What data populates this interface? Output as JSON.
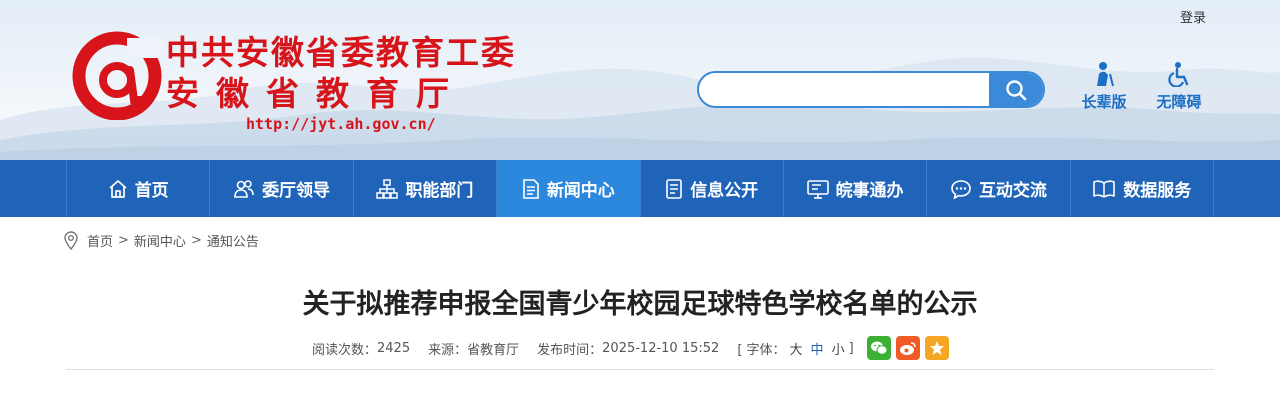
{
  "header": {
    "login_label": "登录",
    "title_line1": "中共安徽省委教育工委",
    "title_line2": "安徽省教育厅",
    "url": "http://jyt.ah.gov.cn/",
    "search": {
      "value": "",
      "placeholder": ""
    },
    "elder_label": "长辈版",
    "accessible_label": "无障碍",
    "brand_red": "#d8141b",
    "accent_blue": "#1c6fc4"
  },
  "nav": {
    "items": [
      {
        "label": "首页",
        "icon": "home-icon"
      },
      {
        "label": "委厅领导",
        "icon": "users-icon"
      },
      {
        "label": "职能部门",
        "icon": "org-chart-icon"
      },
      {
        "label": "新闻中心",
        "icon": "document-icon",
        "active": true
      },
      {
        "label": "信息公开",
        "icon": "list-doc-icon"
      },
      {
        "label": "皖事通办",
        "icon": "monitor-icon"
      },
      {
        "label": "互动交流",
        "icon": "chat-icon"
      },
      {
        "label": "数据服务",
        "icon": "book-icon"
      }
    ],
    "bg_color": "#1f64b8",
    "active_color": "#2b88dd"
  },
  "breadcrumb": {
    "items": [
      "首页",
      "新闻中心",
      "通知公告"
    ],
    "separator": ">"
  },
  "article": {
    "title": "关于拟推荐申报全国青少年校园足球特色学校名单的公示",
    "meta": {
      "views_label": "阅读次数：",
      "views": "2425",
      "source_label": "来源：",
      "source": "省教育厅",
      "time_label": "发布时间：",
      "time": "2025-12-10 15:52",
      "font_open": "[ 字体：",
      "font_large": "大",
      "font_medium": "中",
      "font_small": "小",
      "font_close": "]"
    },
    "share_icons": [
      "wechat-icon",
      "weibo-icon",
      "favorite-icon"
    ]
  }
}
